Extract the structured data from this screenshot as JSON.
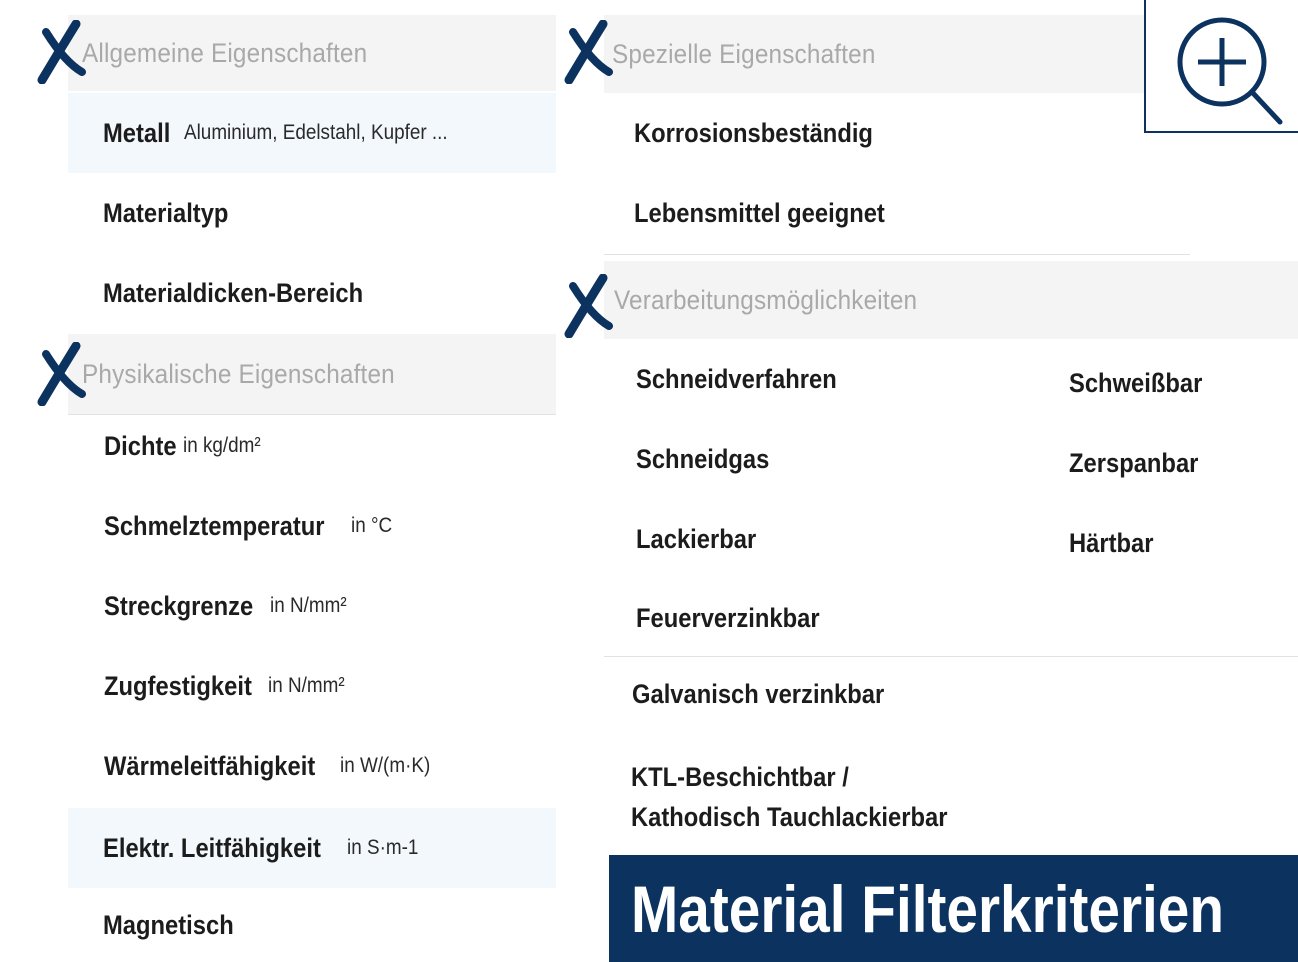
{
  "left_column": {
    "general": {
      "header": "Allgemeine Eigenschaften",
      "items": [
        {
          "label": "Metall",
          "unit": "Aluminium, Edelstahl, Kupfer ..."
        },
        {
          "label": "Materialtyp",
          "unit": ""
        },
        {
          "label": "Materialdicken-Bereich",
          "unit": ""
        }
      ]
    },
    "physical": {
      "header": "Physikalische Eigenschaften",
      "items": [
        {
          "label": "Dichte",
          "unit": "in kg/dm²"
        },
        {
          "label": "Schmelztemperatur",
          "unit": "in °C"
        },
        {
          "label": "Streckgrenze",
          "unit": "in N/mm²"
        },
        {
          "label": "Zugfestigkeit",
          "unit": "in N/mm²"
        },
        {
          "label": "Wärmeleitfähigkeit",
          "unit": "in W/(m·K)"
        },
        {
          "label": "Elektr. Leitfähigkeit",
          "unit": "in S·m-1"
        },
        {
          "label": "Magnetisch",
          "unit": ""
        }
      ]
    }
  },
  "right_column": {
    "special": {
      "header": "Spezielle Eigenschaften",
      "items": [
        {
          "label": "Korrosionsbeständig"
        },
        {
          "label": "Lebensmittel geeignet"
        }
      ]
    },
    "processing": {
      "header": "Verarbeitungsmöglichkeiten",
      "items_left": [
        {
          "label": "Schneidverfahren"
        },
        {
          "label": "Schneidgas"
        },
        {
          "label": "Lackierbar"
        },
        {
          "label": "Feuerverzinkbar"
        }
      ],
      "items_right": [
        {
          "label": "Schweißbar"
        },
        {
          "label": "Zerspanbar"
        },
        {
          "label": "Härtbar"
        }
      ],
      "items_full": [
        {
          "label": "Galvanisch verzinkbar"
        },
        {
          "label": "KTL-Beschichtbar /"
        },
        {
          "label": "Kathodisch Tauchlackierbar"
        }
      ]
    }
  },
  "title": "Material Filterkriterien",
  "icons": {
    "collapse": "x-mark-icon",
    "zoom": "zoom-in-icon"
  },
  "colors": {
    "brand": "#0c335f",
    "header_bg": "#f4f4f4",
    "header_text": "#a9a9a9",
    "highlight_bg": "#f3f8fd"
  }
}
